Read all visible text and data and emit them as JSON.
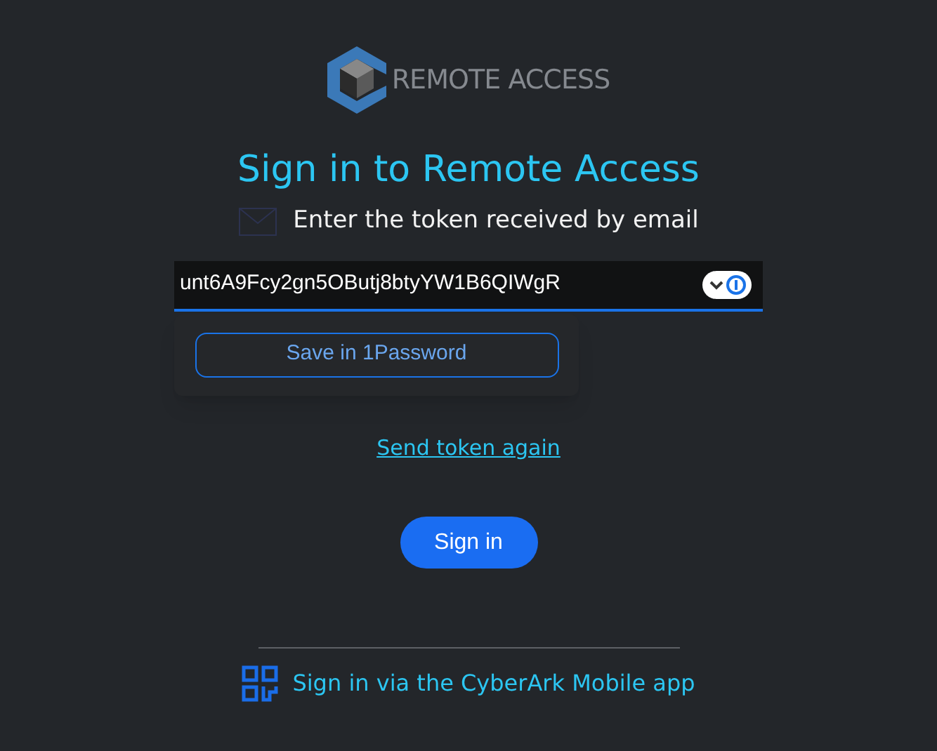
{
  "logo": {
    "text": "REMOTE ACCESS"
  },
  "title": "Sign in to Remote Access",
  "instruction": "Enter the token received by email",
  "token_field": {
    "value": "unt6A9Fcy2gn5OButj8btyYW1B6QIWgR"
  },
  "password_popup": {
    "button": "Save in 1Password"
  },
  "resend_link": "Send token again",
  "sign_in_button": "Sign in",
  "mobile_link": "Sign in via the CyberArk Mobile app"
}
